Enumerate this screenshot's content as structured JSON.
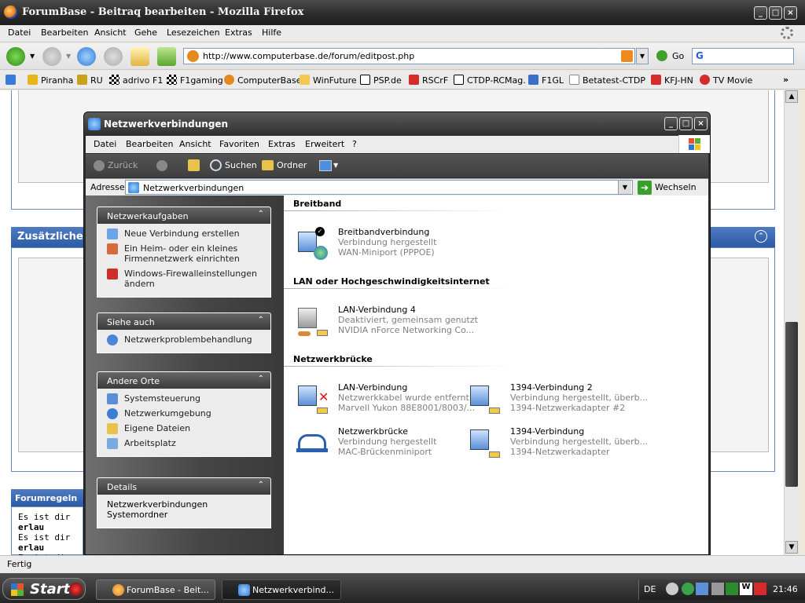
{
  "firefox": {
    "title": "ForumBase - Beitraq bearbeiten - Mozilla Firefox",
    "menu": [
      "Datei",
      "Bearbeiten",
      "Ansicht",
      "Gehe",
      "Lesezeichen",
      "Extras",
      "Hilfe"
    ],
    "url": "http://www.computerbase.de/forum/editpost.php",
    "go_label": "Go",
    "search_value": "G",
    "bookmarks": [
      "Piranha",
      "RU",
      "adrivo F1",
      "F1gaming",
      "ComputerBase",
      "WinFuture",
      "PSP.de",
      "RSCrF",
      "CTDP-RCMag.",
      "F1GL",
      "Betatest-CTDP",
      "KFJ-HN",
      "TV Movie"
    ],
    "overflow": "»",
    "status": "Fertig"
  },
  "page": {
    "section_title": "Zusätzliche",
    "forum_rules_title": "Forumregeln",
    "rules": [
      "Es ist dir erlau",
      "Es ist dir erlau",
      "Es ist dir erlau",
      "Es ist dir erlau"
    ],
    "rules_prefix": "Es ist dir ",
    "rules_bold": "erlau"
  },
  "explorer": {
    "title": "Netzwerkverbindungen",
    "menu": [
      "Datei",
      "Bearbeiten",
      "Ansicht",
      "Favoriten",
      "Extras",
      "Erweitert",
      "?"
    ],
    "toolbar": {
      "back": "Zurück",
      "search": "Suchen",
      "folders": "Ordner"
    },
    "address_label": "Adresse",
    "address_value": "Netzwerkverbindungen",
    "go_label": "Wechseln zu",
    "panels": [
      {
        "title": "Netzwerkaufgaben",
        "items": [
          "Neue Verbindung erstellen",
          "Ein Heim- oder ein kleines Firmennetzwerk einrichten",
          "Windows-Firewalleinstellungen ändern"
        ]
      },
      {
        "title": "Siehe auch",
        "items": [
          "Netzwerkproblembehandlung"
        ]
      },
      {
        "title": "Andere Orte",
        "items": [
          "Systemsteuerung",
          "Netzwerkumgebung",
          "Eigene Dateien",
          "Arbeitsplatz"
        ]
      },
      {
        "title": "Details",
        "items": [
          "Netzwerkverbindungen",
          "Systemordner"
        ]
      }
    ],
    "groups": [
      {
        "name": "Breitband",
        "items": [
          {
            "name": "Breitbandverbindung",
            "status": "Verbindung hergestellt",
            "device": "WAN-Miniport (PPPOE)"
          }
        ]
      },
      {
        "name": "LAN oder Hochgeschwindigkeitsinternet",
        "items": [
          {
            "name": "LAN-Verbindung 4",
            "status": "Deaktiviert, gemeinsam genutzt",
            "device": "NVIDIA nForce Networking Co..."
          }
        ]
      },
      {
        "name": "Netzwerkbrücke",
        "items": [
          {
            "name": "LAN-Verbindung",
            "status": "Netzwerkkabel wurde entfernt",
            "device": "Marvell Yukon 88E8001/8003/..."
          },
          {
            "name": "1394-Verbindung 2",
            "status": "Verbindung hergestellt, überb...",
            "device": "1394-Netzwerkadapter #2"
          },
          {
            "name": "Netzwerkbrücke",
            "status": "Verbindung hergestellt",
            "device": "MAC-Brückenminiport"
          },
          {
            "name": "1394-Verbindung",
            "status": "Verbindung hergestellt, überb...",
            "device": "1394-Netzwerkadapter"
          }
        ]
      }
    ]
  },
  "taskbar": {
    "start": "Start",
    "tasks": [
      "ForumBase - Beit...",
      "Netzwerkverbind..."
    ],
    "lang": "DE",
    "clock": "21:46"
  }
}
